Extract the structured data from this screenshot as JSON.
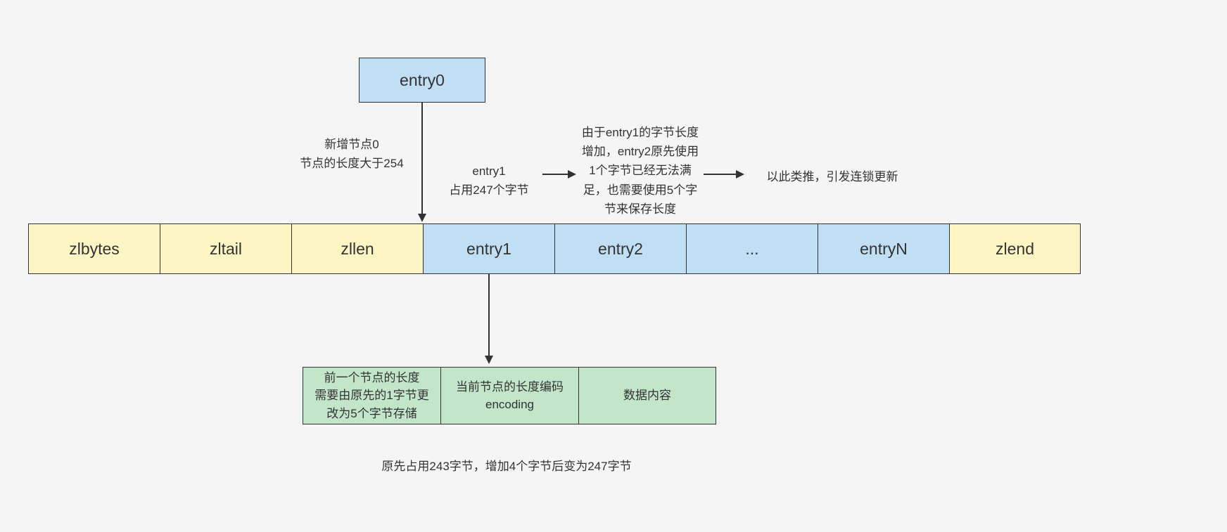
{
  "entry0": {
    "label": "entry0"
  },
  "main_row": {
    "zlbytes": "zlbytes",
    "zltail": "zltail",
    "zllen": "zllen",
    "entry1": "entry1",
    "entry2": "entry2",
    "ellipsis": "...",
    "entryN": "entryN",
    "zlend": "zlend"
  },
  "detail_row": {
    "prev_len": "前一个节点的长度\n需要由原先的1字节更\n改为5个字节存储",
    "encoding": "当前节点的长度编码\nencoding",
    "data": "数据内容"
  },
  "annotations": {
    "new_node": "新增节点0\n节点的长度大于254",
    "entry1_bytes": "entry1\n占用247个字节",
    "entry2_reason": "由于entry1的字节长度\n增加，entry2原先使用\n1个字节已经无法满\n足，也需要使用5个字\n节来保存长度",
    "chain_update": "以此类推，引发连锁更新",
    "bottom_note": "原先占用243字节，增加4个字节后变为247字节"
  }
}
